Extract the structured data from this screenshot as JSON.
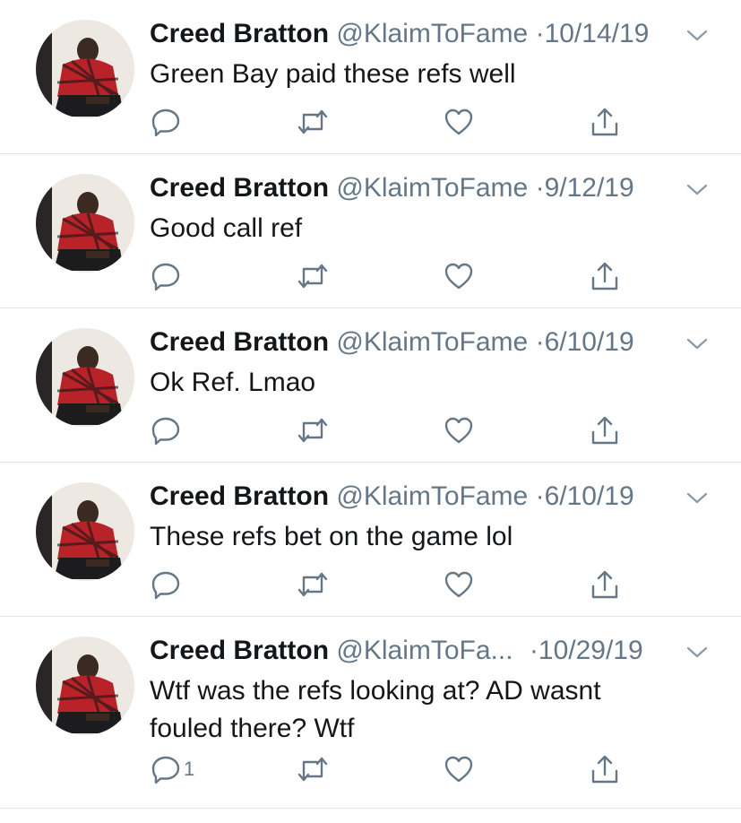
{
  "colors": {
    "text": "#14171a",
    "secondary": "#657786",
    "divider": "#e1e8ed"
  },
  "tweets": [
    {
      "name": "Creed Bratton",
      "handle": "@KlaimToFame",
      "separator": "·",
      "date": "10/14/19",
      "text": "Green Bay paid these refs well",
      "reply_count": ""
    },
    {
      "name": "Creed Bratton",
      "handle": "@KlaimToFame",
      "separator": "·",
      "date": "9/12/19",
      "text": "Good call ref",
      "reply_count": ""
    },
    {
      "name": "Creed Bratton",
      "handle": "@KlaimToFame",
      "separator": "·",
      "date": "6/10/19",
      "text": "Ok Ref. Lmao",
      "reply_count": ""
    },
    {
      "name": "Creed Bratton",
      "handle": "@KlaimToFame",
      "separator": "·",
      "date": "6/10/19",
      "text": "These refs bet on the game lol",
      "reply_count": ""
    },
    {
      "name": "Creed Bratton",
      "handle": "@KlaimToFa...",
      "separator": "·",
      "date": "10/29/19",
      "text": "Wtf was the refs looking at? AD wasnt fouled there? Wtf",
      "reply_count": "1"
    }
  ],
  "icons": {
    "reply": "reply-icon",
    "retweet": "retweet-icon",
    "like": "heart-icon",
    "share": "share-icon",
    "menu": "chevron-down-icon",
    "avatar": "avatar"
  }
}
